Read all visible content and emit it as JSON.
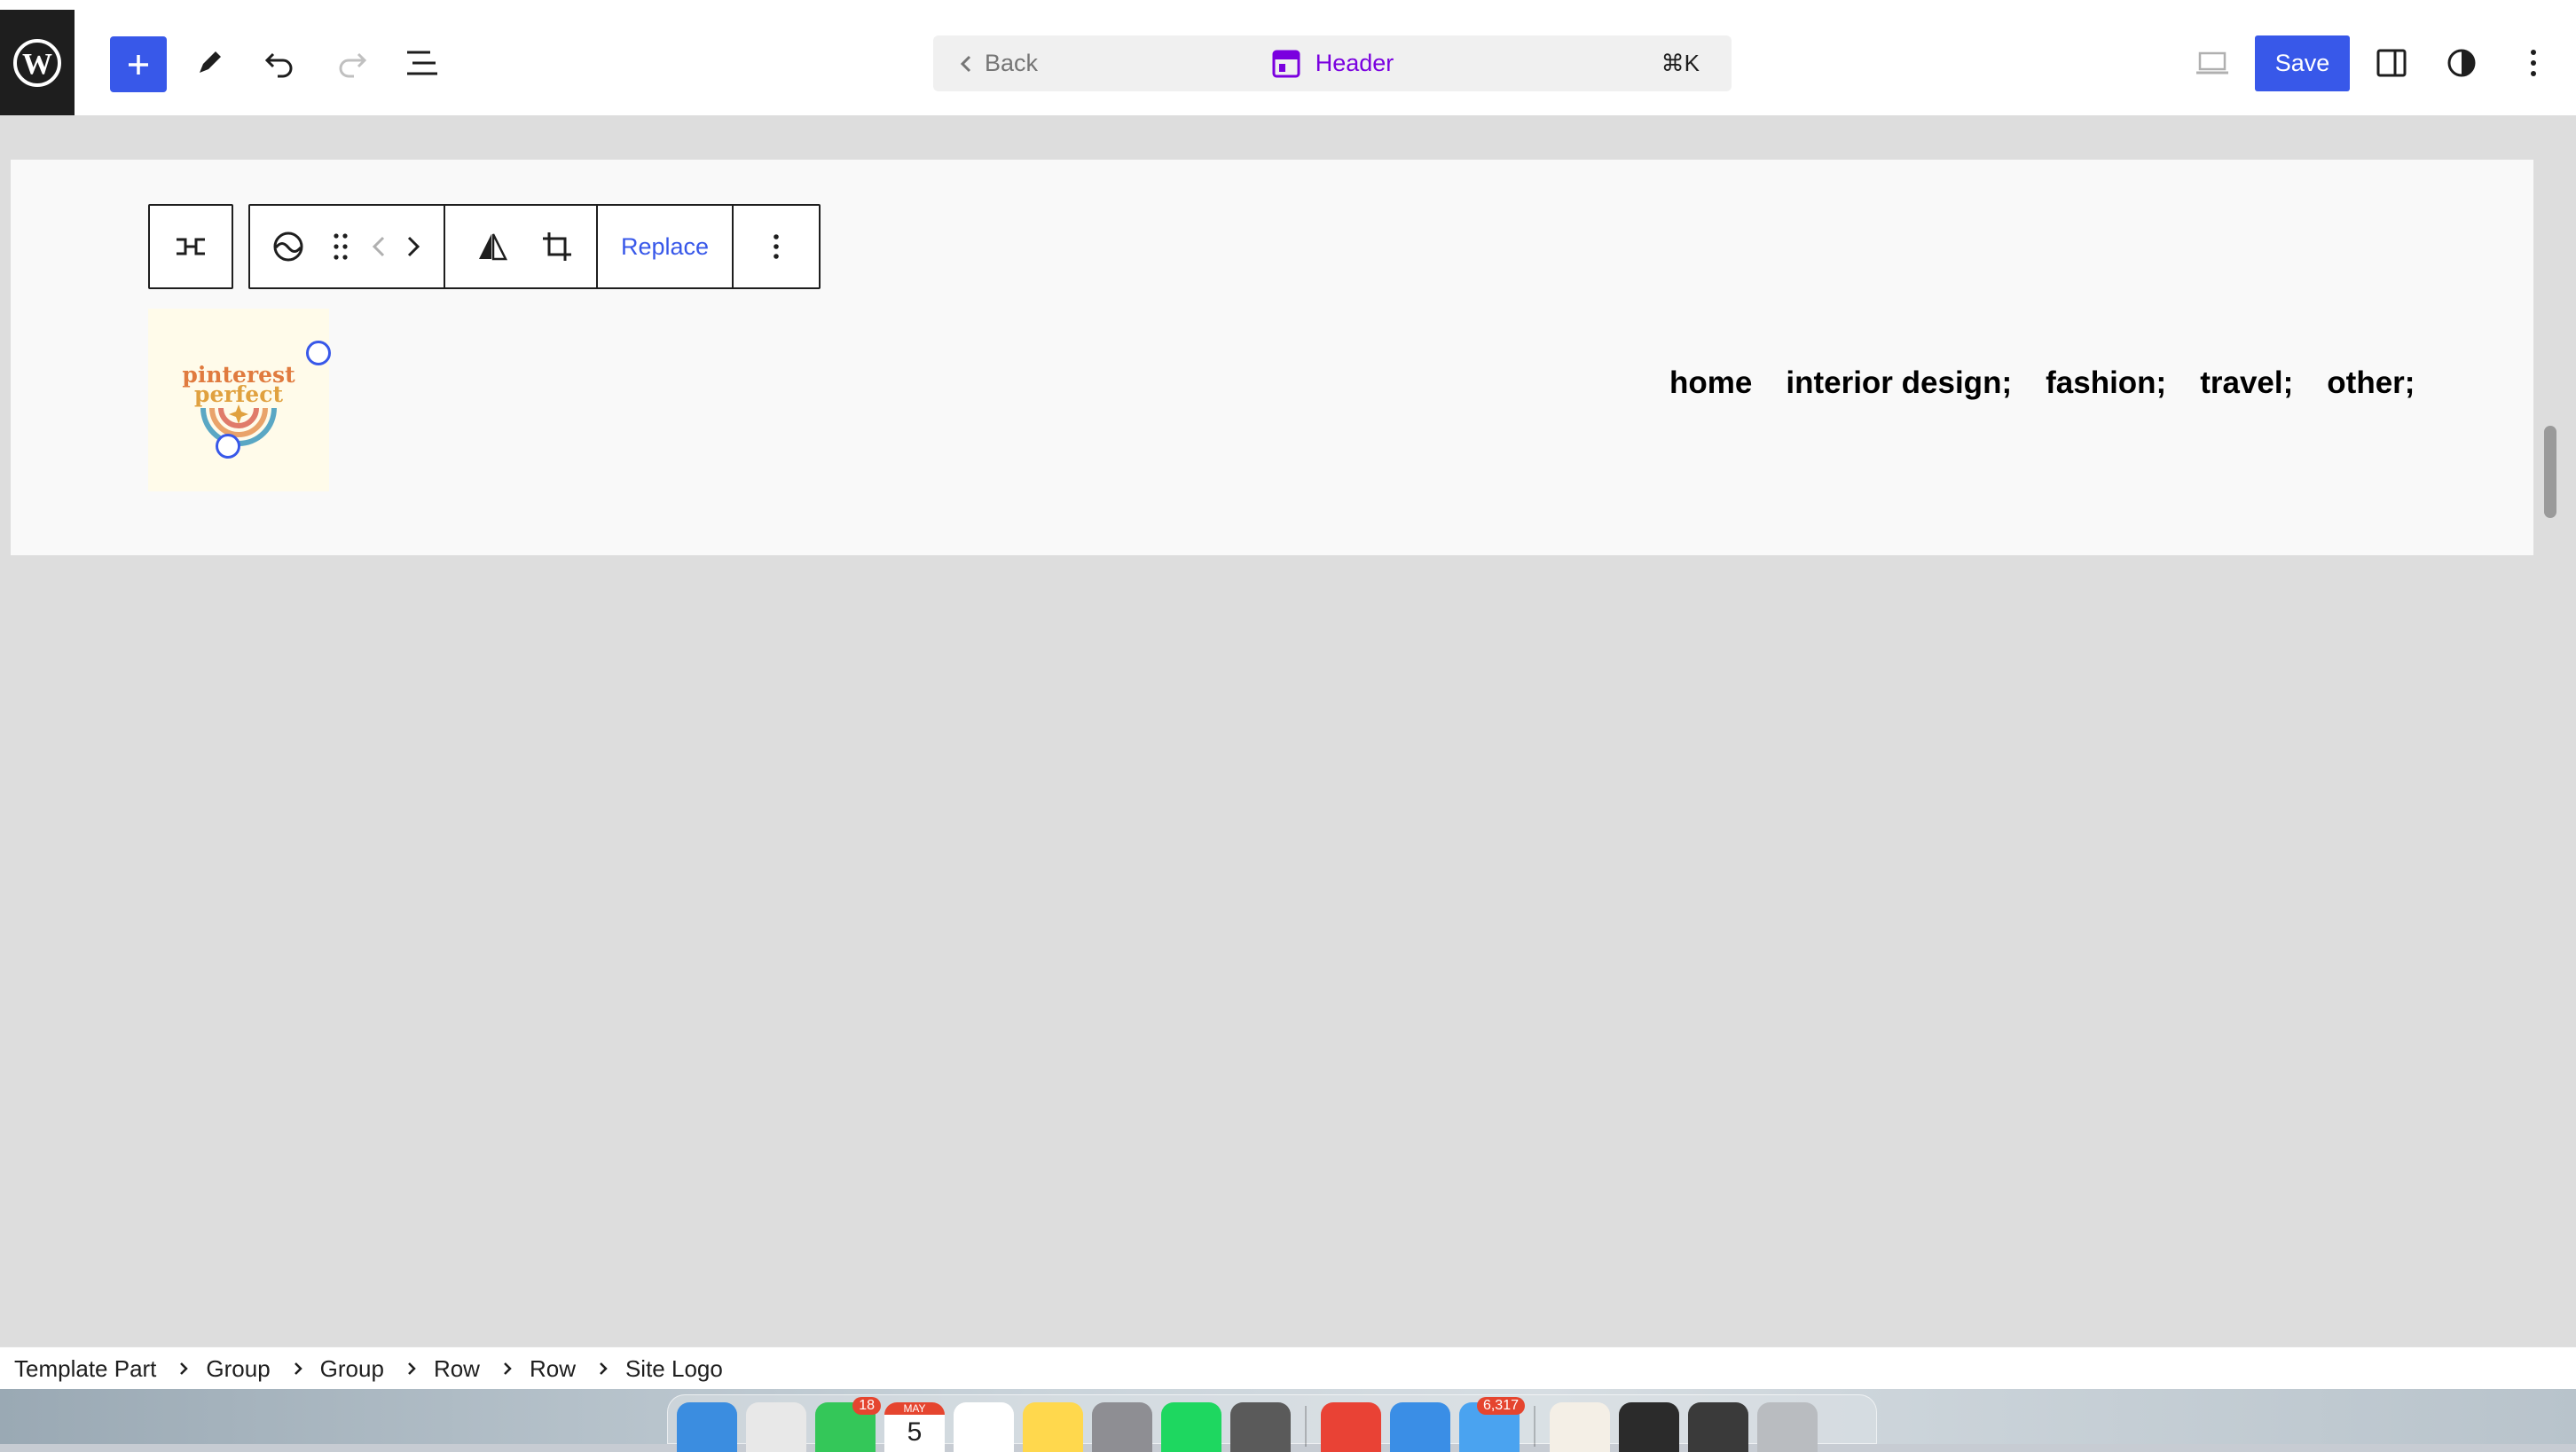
{
  "topbar": {
    "command_bar": {
      "back_label": "Back",
      "title": "Header",
      "shortcut": "⌘K"
    },
    "save_label": "Save"
  },
  "block_toolbar": {
    "replace_label": "Replace"
  },
  "site_logo": {
    "line1": "pinterest",
    "line2": "perfect"
  },
  "nav": {
    "items": [
      "home",
      "interior design;",
      "fashion;",
      "travel;",
      "other;"
    ]
  },
  "breadcrumb": {
    "items": [
      "Template Part",
      "Group",
      "Group",
      "Row",
      "Row",
      "Site Logo"
    ]
  },
  "dock": {
    "apps": [
      {
        "icon": "finder-icon",
        "color": "#3b8de0"
      },
      {
        "icon": "launchpad-icon",
        "color": "#e8e8e8"
      },
      {
        "icon": "messages-icon",
        "color": "#34c759",
        "badge": "18"
      },
      {
        "icon": "calendar-icon",
        "color": "#ffffff",
        "month": "MAY",
        "day": "5"
      },
      {
        "icon": "reminders-icon",
        "color": "#ffffff"
      },
      {
        "icon": "notes-icon",
        "color": "#ffd84d"
      },
      {
        "icon": "system-settings-icon",
        "color": "#8e8e93"
      },
      {
        "icon": "spotify-icon",
        "color": "#1ed760"
      },
      {
        "icon": "calculator-icon",
        "color": "#5a5a5a"
      },
      {
        "icon": "chrome-icon",
        "color": "#e94235"
      },
      {
        "icon": "safari-icon",
        "color": "#3a8ee6"
      },
      {
        "icon": "mail-icon",
        "color": "#4aa3f0",
        "badge": "6,317"
      },
      {
        "icon": "document-thumbnail-icon",
        "color": "#f4efe6"
      },
      {
        "icon": "screenshot-thumbnail-icon",
        "color": "#2b2b2b"
      },
      {
        "icon": "screenshot-stack-icon",
        "color": "#3a3a3a"
      },
      {
        "icon": "trash-icon",
        "color": "#b9bcc0"
      }
    ]
  },
  "colors": {
    "accent": "#3858e9",
    "template_purple": "#7a00df",
    "wp_dark": "#1e1e1e"
  }
}
